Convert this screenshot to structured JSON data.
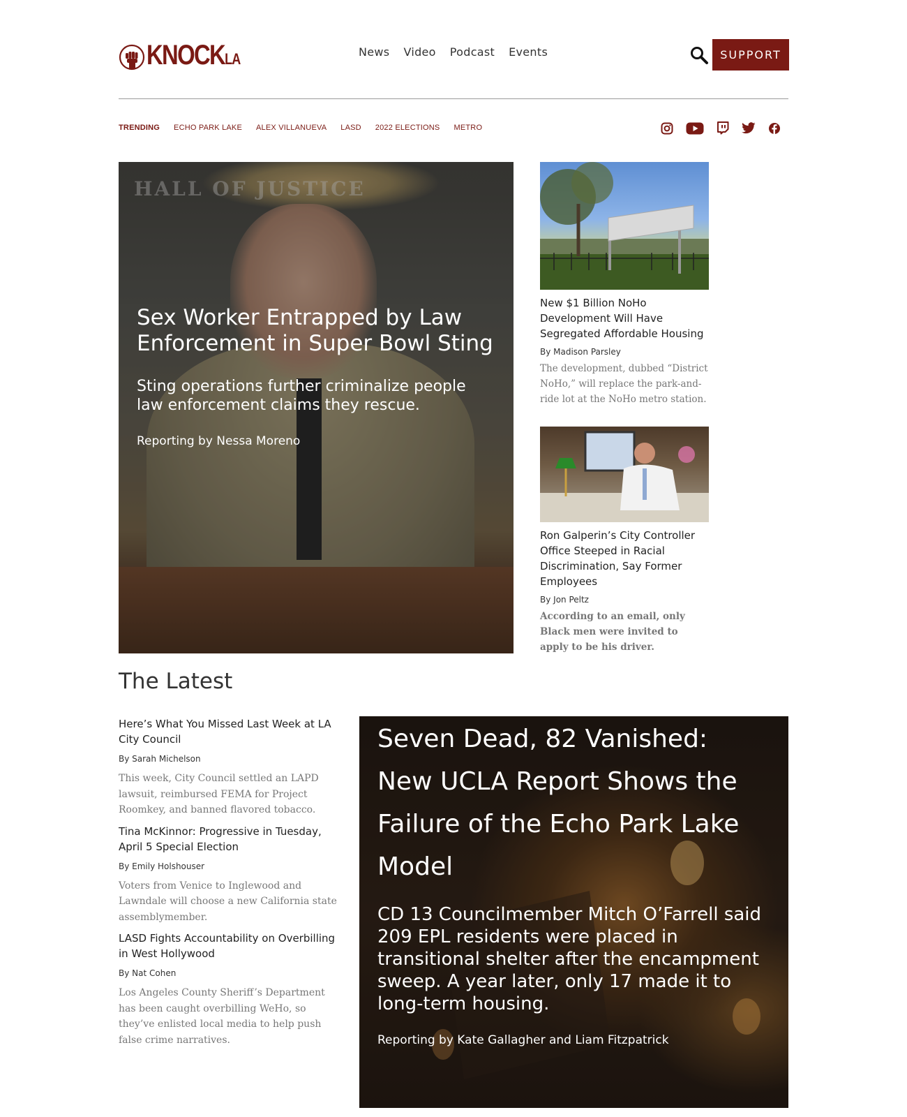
{
  "brand": {
    "logo_main": "KNOCK",
    "logo_sub": "LA",
    "accent_color": "#7a1a14"
  },
  "nav": {
    "items": [
      {
        "label": "News"
      },
      {
        "label": "Video"
      },
      {
        "label": "Podcast"
      },
      {
        "label": "Events"
      }
    ],
    "support_label": "SUPPORT"
  },
  "trending": {
    "label": "TRENDING",
    "items": [
      "ECHO PARK LAKE",
      "ALEX VILLANUEVA",
      "LASD",
      "2022 ELECTIONS",
      "METRO"
    ]
  },
  "social": [
    "instagram-icon",
    "youtube-icon",
    "twitch-icon",
    "twitter-icon",
    "facebook-icon"
  ],
  "hero": {
    "backdrop_text": "HALL OF JUSTICE",
    "title": "Sex Worker Entrapped by Law Enforcement in Super Bowl Sting",
    "subtitle": "Sting operations further criminalize people law enforcement claims they rescue.",
    "byline": "Reporting by Nessa Moreno"
  },
  "side_stories": [
    {
      "title": "New $1 Billion NoHo Development Will Have Segregated Affordable Housing",
      "byline": "By Madison Parsley",
      "description": "The development, dubbed “District NoHo,” will replace the park-and-ride lot at the NoHo metro station."
    },
    {
      "title": "Ron Galperin’s City Controller Office Steeped in Racial Discrimination, Say Former Employees",
      "byline": "By Jon Peltz",
      "description": "According to an email, only Black men were invited to apply to be his driver."
    }
  ],
  "latest": {
    "heading": "The Latest",
    "items": [
      {
        "title": "Here’s What You Missed Last Week at LA City Council",
        "byline": "By Sarah Michelson",
        "description": "This week, City Council settled an LAPD lawsuit, reimbursed FEMA for Project Roomkey, and banned flavored tobacco."
      },
      {
        "title": "Tina McKinnor: Progressive in Tuesday, April 5 Special Election",
        "byline": "By Emily Holshouser",
        "description": "Voters from Venice to Inglewood and Lawndale will choose a new California state assemblymember."
      },
      {
        "title": "LASD Fights Accountability on Overbilling in West Hollywood",
        "byline": "By Nat Cohen",
        "description": "Los Angeles County Sheriff’s Department has been caught overbilling WeHo, so they’ve enlisted local media to help push false crime narratives."
      }
    ],
    "feature": {
      "title": "Seven Dead, 82 Vanished: New UCLA Report Shows the Failure of the Echo Park Lake Model",
      "subtitle": "CD 13 Councilmember Mitch O’Farrell said 209 EPL residents were placed in transitional shelter after the encampment sweep. A year later, only 17 made it to long-term housing.",
      "byline": "Reporting by Kate Gallagher and Liam Fitzpatrick"
    }
  }
}
